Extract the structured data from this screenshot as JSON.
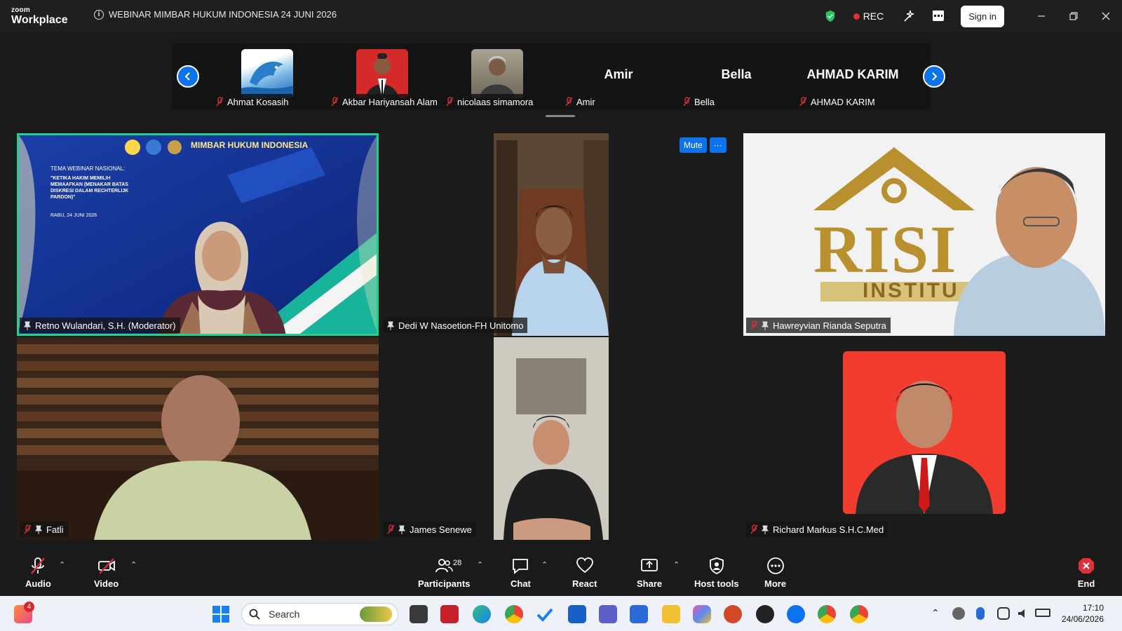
{
  "app": {
    "brand_top": "zoom",
    "brand_bottom": "Workplace",
    "meeting_title": "WEBINAR MIMBAR HUKUM INDONESIA 24 JUNI 2026",
    "rec_label": "REC",
    "signin_label": "Sign in"
  },
  "strip": {
    "participants": [
      {
        "name": "Ahmat Kosasih",
        "type": "image"
      },
      {
        "name": "Akbar Hariyansah Alam",
        "type": "image"
      },
      {
        "name": "nicolaas simamora",
        "type": "image"
      },
      {
        "name": "Amir",
        "display": "Amir",
        "type": "text"
      },
      {
        "name": "Bella",
        "display": "Bella",
        "type": "text"
      },
      {
        "name": "AHMAD KARIM",
        "display": "AHMAD KARIM",
        "type": "text"
      }
    ]
  },
  "tiles": [
    {
      "name": "Retno Wulandari, S.H. (Moderator)",
      "active": true,
      "muted": false
    },
    {
      "name": "Dedi W Nasoetion-FH Unitomo",
      "muted": false
    },
    {
      "name": "Hawreyvian Rianda Seputra",
      "muted": true
    },
    {
      "name": "Fatli",
      "muted": true
    },
    {
      "name": "James Senewe",
      "muted": true
    },
    {
      "name": "Richard Markus S.H.C.Med",
      "muted": true
    }
  ],
  "slide": {
    "header": "MIMBAR HUKUM INDONESIA",
    "theme": "TEMA WEBINAR NASIONAL:",
    "quote": "\"KETIKA HAKIM MEMILIH MEMAAFKAN (MENAKAR BATAS DISKRESI DALAM RECHTERLIJK PARDON)\"",
    "date": "RABU, 24 JUNI 2026"
  },
  "logo_text": {
    "letters": "RISI",
    "sub": "INSTITU"
  },
  "hover": {
    "mute_label": "Mute",
    "more_label": "···"
  },
  "toolbar": {
    "audio": "Audio",
    "video": "Video",
    "participants": "Participants",
    "participant_count": "28",
    "chat": "Chat",
    "react": "React",
    "share": "Share",
    "host_tools": "Host tools",
    "more": "More",
    "end": "End"
  },
  "taskbar": {
    "search_placeholder": "Search",
    "time": "17:10",
    "date": "24/06/2026",
    "notify_count": "4"
  },
  "colors": {
    "accent": "#0e72ed",
    "active_border": "#23d18b",
    "end": "#e0303a"
  }
}
